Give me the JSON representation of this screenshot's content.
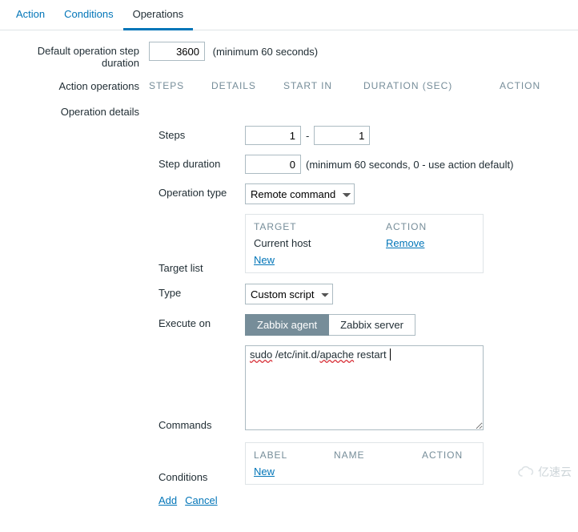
{
  "tabs": {
    "action": "Action",
    "conditions": "Conditions",
    "operations": "Operations"
  },
  "form": {
    "default_duration_label": "Default operation step duration",
    "default_duration_value": "3600",
    "default_duration_hint": "(minimum 60 seconds)",
    "action_operations_label": "Action operations",
    "ops_header": {
      "steps": "STEPS",
      "details": "DETAILS",
      "start_in": "START IN",
      "duration": "DURATION (SEC)",
      "action": "ACTION"
    },
    "operation_details_label": "Operation details"
  },
  "details": {
    "steps_label": "Steps",
    "step_from": "1",
    "step_to": "1",
    "step_duration_label": "Step duration",
    "step_duration_value": "0",
    "step_duration_hint": "(minimum 60 seconds, 0 - use action default)",
    "op_type_label": "Operation type",
    "op_type_value": "Remote command",
    "target_list_label": "Target list",
    "target_box": {
      "head_target": "TARGET",
      "head_action": "ACTION",
      "row_target": "Current host",
      "row_action": "Remove",
      "new": "New"
    },
    "type_label": "Type",
    "type_value": "Custom script",
    "execute_label": "Execute on",
    "execute_options": {
      "agent": "Zabbix agent",
      "server": "Zabbix server"
    },
    "commands_label": "Commands",
    "commands_parts": {
      "w1": "sudo",
      "p1": " /etc/init.d/",
      "w2": "apache",
      "p2": " restart"
    },
    "commands_plain": "sudo /etc/init.d/apache restart",
    "conditions_label": "Conditions",
    "cond_box": {
      "label": "LABEL",
      "name": "NAME",
      "action": "ACTION",
      "new": "New"
    },
    "actions": {
      "add": "Add",
      "cancel": "Cancel"
    }
  },
  "watermark": "亿速云"
}
